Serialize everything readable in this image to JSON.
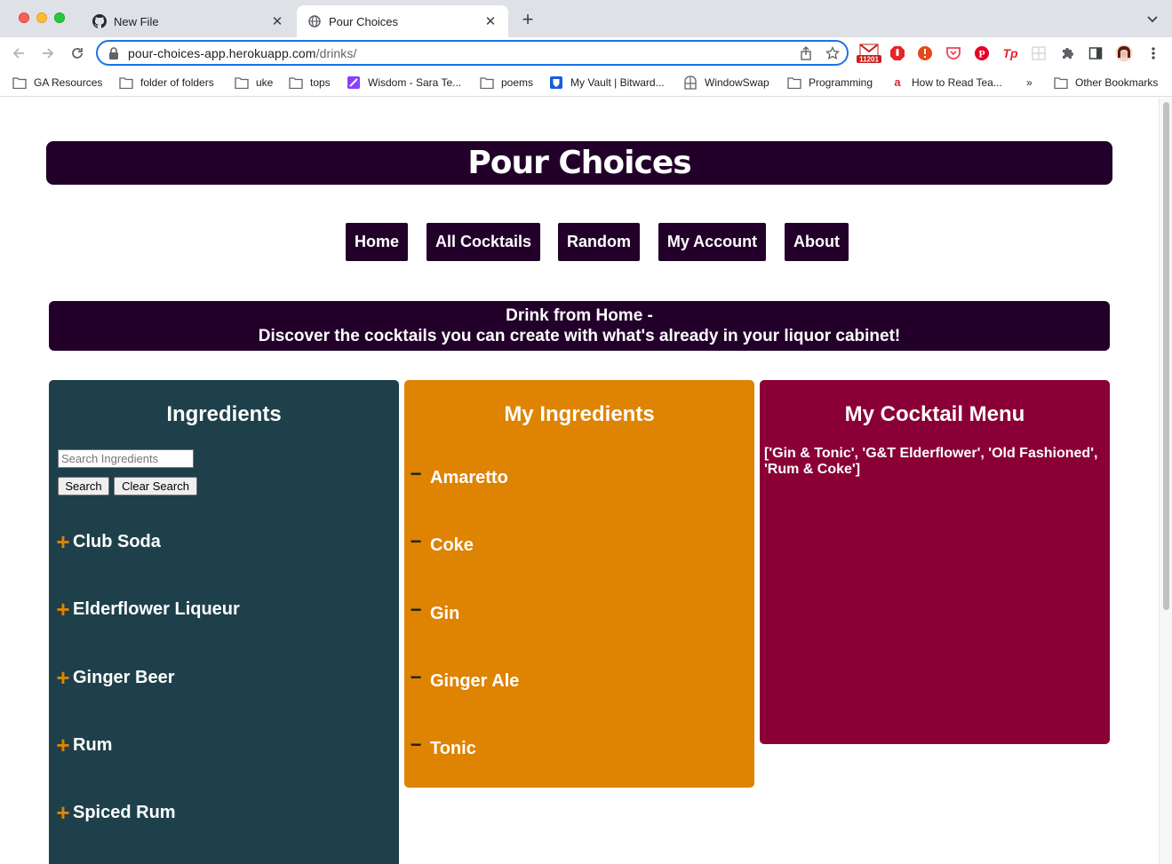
{
  "browser": {
    "tabs": [
      {
        "title": "New File",
        "icon": "github-icon"
      },
      {
        "title": "Pour Choices",
        "icon": "globe-icon"
      }
    ],
    "url": {
      "host": "pour-choices-app.herokuapp.com",
      "path": "/drinks/"
    },
    "extension_badge": "11201",
    "bookmarks": [
      "GA Resources",
      "folder of folders",
      "uke",
      "tops",
      "Wisdom - Sara Te...",
      "poems",
      "My Vault | Bitward...",
      "WindowSwap",
      "Programming",
      "How to Read Tea..."
    ],
    "bookmarks_overflow": "»",
    "other_bookmarks": "Other Bookmarks"
  },
  "site": {
    "title": "Pour Choices",
    "nav": [
      "Home",
      "All Cocktails",
      "Random",
      "My Account",
      "About"
    ],
    "hero": {
      "line1": "Drink from Home -",
      "line2": "Discover the cocktails you can create with what's already in your liquor cabinet!"
    },
    "ingredients": {
      "heading": "Ingredients",
      "search_placeholder": "Search Ingredients",
      "search_label": "Search",
      "clear_label": "Clear Search",
      "items": [
        "Club Soda",
        "Elderflower Liqueur",
        "Ginger Beer",
        "Rum",
        "Spiced Rum"
      ]
    },
    "my_ingredients": {
      "heading": "My Ingredients",
      "items": [
        "Amaretto",
        "Coke",
        "Gin",
        "Ginger Ale",
        "Tonic"
      ]
    },
    "cocktail_menu": {
      "heading": "My Cocktail Menu",
      "text": "['Gin & Tonic', 'G&T Elderflower', 'Old Fashioned', 'Rum & Coke']"
    }
  },
  "colors": {
    "brand_dark": "#22002a",
    "ingredients_bg": "#1e404b",
    "my_ingredients_bg": "#de8302",
    "menu_bg": "#8a0036"
  }
}
